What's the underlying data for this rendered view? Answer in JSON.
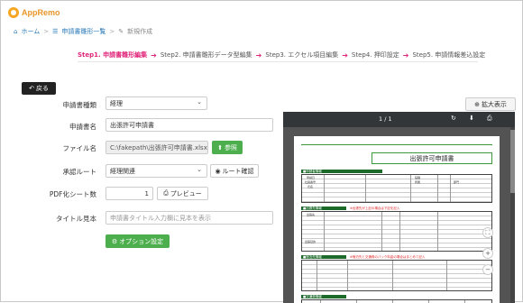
{
  "app": {
    "name": "AppRemo"
  },
  "breadcrumb": {
    "home": "ホーム",
    "list": "申請書雛形一覧",
    "current": "新規作成"
  },
  "steps": [
    {
      "label": "Step1. 申請書雛形編集",
      "active": true
    },
    {
      "label": "Step2. 申請書雛形データ型編集",
      "active": false
    },
    {
      "label": "Step3. エクセル項目編集",
      "active": false
    },
    {
      "label": "Step4. 押印設定",
      "active": false
    },
    {
      "label": "Step5. 申請情報差込設定",
      "active": false
    }
  ],
  "buttons": {
    "back": "戻る",
    "expand": "拡大表示",
    "browse": "参照",
    "route_check": "ルート確認",
    "preview": "プレビュー",
    "option": "オプション設定"
  },
  "form": {
    "type_label": "申請書種類",
    "type_value": "経理",
    "name_label": "申請書名",
    "name_value": "出張許可申請書",
    "file_label": "ファイル名",
    "file_value": "C:\\fakepath\\出張許可申請書.xlsx",
    "route_label": "承認ルート",
    "route_value": "経理関連",
    "pdf_label": "PDF化シート数",
    "pdf_value": "1",
    "title_label": "タイトル見本",
    "title_placeholder": "申請書タイトル入力欄に見本を表示"
  },
  "viewer": {
    "page_indicator": "1 / 1",
    "doc_title": "出張許可申請書",
    "sections": [
      "■申請者情報",
      "■出張先情報",
      "■宿泊先情報",
      "■交通費情報"
    ],
    "red_notes": [
      "※出張先が上記の場合は下記を記入",
      "※宿泊先と交通費のパック料金の場合はまとめて記入"
    ],
    "cells": [
      "申請日",
      "社員番号",
      "氏名",
      "役職",
      "所属",
      "部門",
      "出張先",
      "出張目的"
    ]
  }
}
